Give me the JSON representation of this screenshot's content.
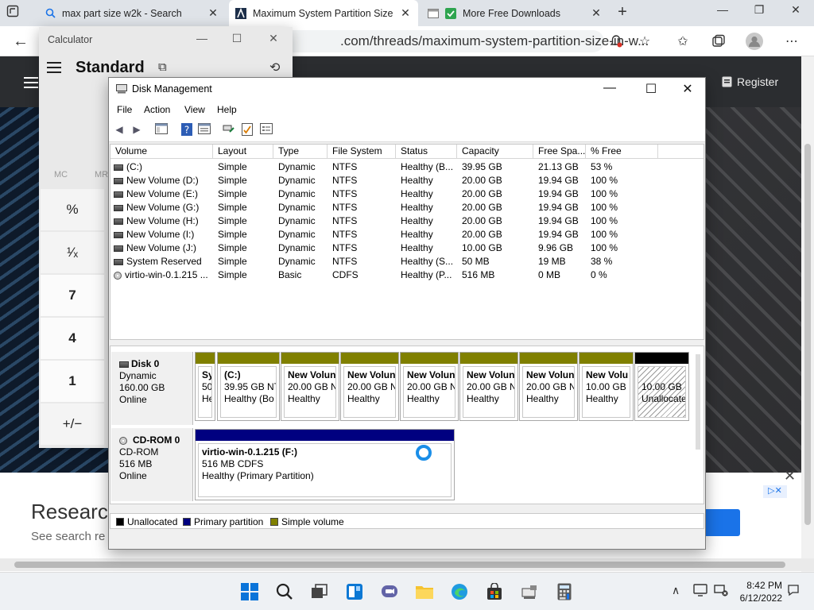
{
  "browser": {
    "tabs": [
      {
        "label": "max part size w2k - Search",
        "icon": "search-icon"
      },
      {
        "label": "Maximum System Partition Size",
        "icon": "site-logo-icon"
      },
      {
        "label": "More Free Downloads",
        "icon": "check-icon"
      }
    ],
    "address_visible": ".com/threads/maximum-system-partition-size-in-w...",
    "site": {
      "register_label": "Register"
    },
    "ad": {
      "title": "Researc",
      "subtitle": "See search re"
    }
  },
  "calculator": {
    "title": "Calculator",
    "mode": "Standard",
    "memory": [
      "MC",
      "MR"
    ],
    "keys": [
      "%",
      "¹⁄ₓ",
      "7",
      "4",
      "1",
      "+/−"
    ]
  },
  "disk_management": {
    "title": "Disk Management",
    "menu": [
      "File",
      "Action",
      "View",
      "Help"
    ],
    "columns": [
      "Volume",
      "Layout",
      "Type",
      "File System",
      "Status",
      "Capacity",
      "Free Spa...",
      "% Free"
    ],
    "rows": [
      {
        "volume": "(C:)",
        "layout": "Simple",
        "type": "Dynamic",
        "fs": "NTFS",
        "status": "Healthy (B...",
        "capacity": "39.95 GB",
        "free": "21.13 GB",
        "pct": "53 %",
        "kind": "disk"
      },
      {
        "volume": "New Volume (D:)",
        "layout": "Simple",
        "type": "Dynamic",
        "fs": "NTFS",
        "status": "Healthy",
        "capacity": "20.00 GB",
        "free": "19.94 GB",
        "pct": "100 %",
        "kind": "disk"
      },
      {
        "volume": "New Volume (E:)",
        "layout": "Simple",
        "type": "Dynamic",
        "fs": "NTFS",
        "status": "Healthy",
        "capacity": "20.00 GB",
        "free": "19.94 GB",
        "pct": "100 %",
        "kind": "disk"
      },
      {
        "volume": "New Volume (G:)",
        "layout": "Simple",
        "type": "Dynamic",
        "fs": "NTFS",
        "status": "Healthy",
        "capacity": "20.00 GB",
        "free": "19.94 GB",
        "pct": "100 %",
        "kind": "disk"
      },
      {
        "volume": "New Volume (H:)",
        "layout": "Simple",
        "type": "Dynamic",
        "fs": "NTFS",
        "status": "Healthy",
        "capacity": "20.00 GB",
        "free": "19.94 GB",
        "pct": "100 %",
        "kind": "disk"
      },
      {
        "volume": "New Volume (I:)",
        "layout": "Simple",
        "type": "Dynamic",
        "fs": "NTFS",
        "status": "Healthy",
        "capacity": "20.00 GB",
        "free": "19.94 GB",
        "pct": "100 %",
        "kind": "disk"
      },
      {
        "volume": "New Volume (J:)",
        "layout": "Simple",
        "type": "Dynamic",
        "fs": "NTFS",
        "status": "Healthy",
        "capacity": "10.00 GB",
        "free": "9.96 GB",
        "pct": "100 %",
        "kind": "disk"
      },
      {
        "volume": "System Reserved",
        "layout": "Simple",
        "type": "Dynamic",
        "fs": "NTFS",
        "status": "Healthy (S...",
        "capacity": "50 MB",
        "free": "19 MB",
        "pct": "38 %",
        "kind": "disk"
      },
      {
        "volume": "virtio-win-0.1.215 ...",
        "layout": "Simple",
        "type": "Basic",
        "fs": "CDFS",
        "status": "Healthy (P...",
        "capacity": "516 MB",
        "free": "0 MB",
        "pct": "0 %",
        "kind": "cd"
      }
    ],
    "disk0": {
      "name": "Disk 0",
      "type": "Dynamic",
      "size": "160.00 GB",
      "state": "Online",
      "partitions": [
        {
          "name": "Sy",
          "l2": "50",
          "l3": "He",
          "color": "#808000"
        },
        {
          "name": "(C:)",
          "l2": "39.95 GB NT",
          "l3": "Healthy (Bo",
          "color": "#808000"
        },
        {
          "name": "New Volun",
          "l2": "20.00 GB NT",
          "l3": "Healthy",
          "color": "#808000"
        },
        {
          "name": "New Volun",
          "l2": "20.00 GB NT",
          "l3": "Healthy",
          "color": "#808000"
        },
        {
          "name": "New Volun",
          "l2": "20.00 GB NT",
          "l3": "Healthy",
          "color": "#808000"
        },
        {
          "name": "New Volun",
          "l2": "20.00 GB NT",
          "l3": "Healthy",
          "color": "#808000"
        },
        {
          "name": "New Volun",
          "l2": "20.00 GB NT",
          "l3": "Healthy",
          "color": "#808000"
        },
        {
          "name": "New Volu",
          "l2": "10.00 GB N",
          "l3": "Healthy",
          "color": "#808000"
        },
        {
          "name": "",
          "l2": "10.00 GB",
          "l3": "Unallocate",
          "color": "#000000"
        }
      ]
    },
    "cdrom0": {
      "name": "CD-ROM 0",
      "type": "CD-ROM",
      "size": "516 MB",
      "state": "Online",
      "partition": {
        "name": "virtio-win-0.1.215  (F:)",
        "l2": "516 MB CDFS",
        "l3": "Healthy (Primary Partition)",
        "color": "#000080"
      }
    },
    "legend": [
      {
        "label": "Unallocated",
        "color": "#000000"
      },
      {
        "label": "Primary partition",
        "color": "#000080"
      },
      {
        "label": "Simple volume",
        "color": "#808000"
      }
    ]
  },
  "taskbar": {
    "time": "8:42 PM",
    "date": "6/12/2022"
  }
}
